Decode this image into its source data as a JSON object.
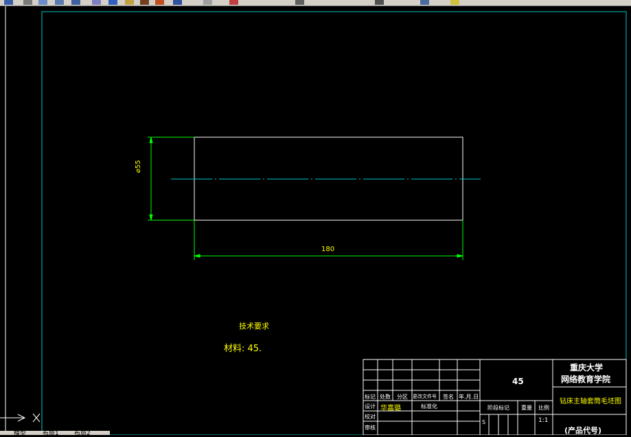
{
  "toolbar": {
    "icons": [
      "save-icon",
      "print-icon",
      "preview-icon",
      "publish-icon",
      "undo-icon",
      "redo-icon",
      "pan-icon",
      "zoom-realtime-icon",
      "zoom-window-icon",
      "zoom-previous-icon",
      "properties-icon",
      "design-center-icon",
      "layer-icon",
      "text-style-icon",
      "table-icon"
    ]
  },
  "drawing": {
    "dimension_vertical": "⌀55",
    "dimension_horizontal": "180",
    "tech_requirements_title": "技术要求",
    "material_label": "材料: 45."
  },
  "title_block": {
    "header_cells": [
      "标记",
      "处数",
      "分区",
      "更改文件号",
      "签名",
      "年.月.日"
    ],
    "row_design": "设计",
    "designer_name": "华嘉璐",
    "standardization": "标准化",
    "row_check": "校对",
    "row_review": "审核",
    "material_code": "45",
    "stage_mark": "阶段标记",
    "weight": "重量",
    "scale_label": "比例",
    "scale_value": "1:1",
    "stage_value": "S",
    "school_name": "重庆大学",
    "school_college": "网络教育学院",
    "drawing_name": "钻床主轴套筒毛坯图",
    "product_code": "(产品代号)"
  },
  "layout_tabs": [
    "模型",
    "布局1",
    "布局2"
  ],
  "colors": {
    "background": "#000000",
    "border": "#00c8c8",
    "outline": "#ffffff",
    "dimension": "#00ff00",
    "text": "#ffff00",
    "centerline": "#00c8c8"
  }
}
